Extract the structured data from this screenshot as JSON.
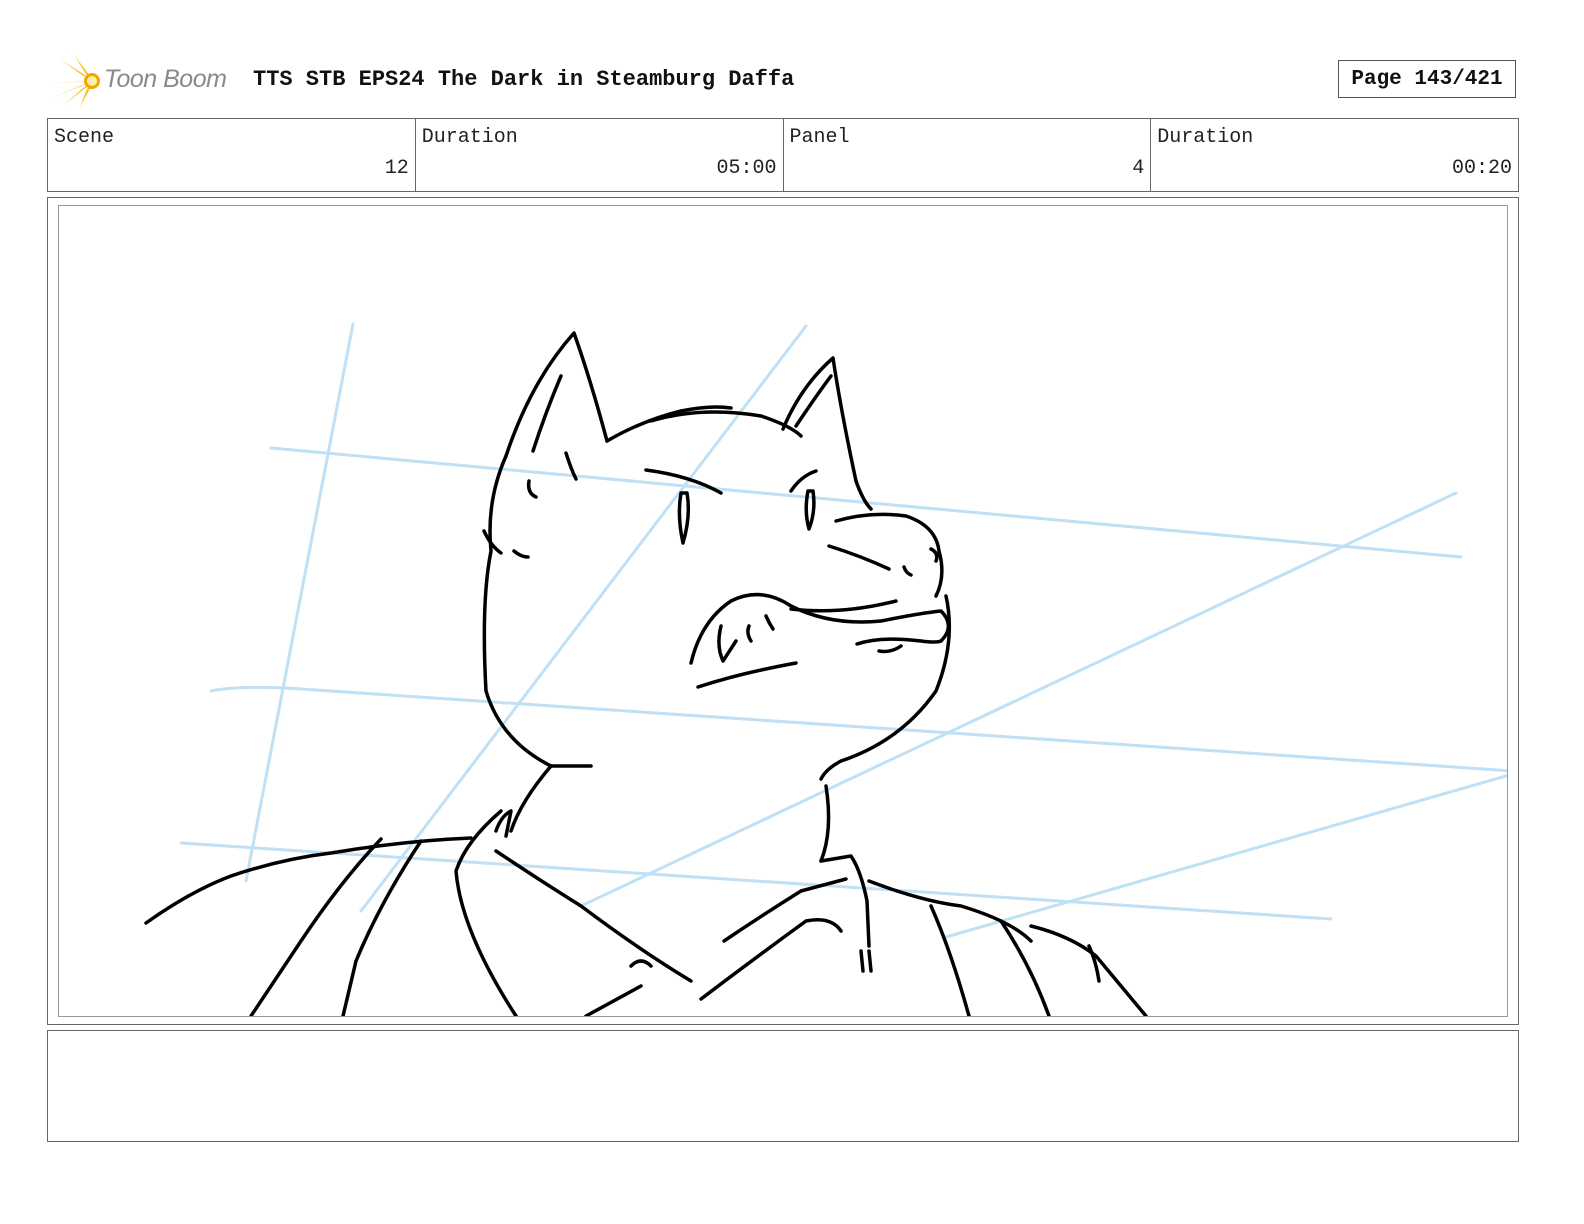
{
  "header": {
    "logo_text": "Toon Boom",
    "title": "TTS STB EPS24 The Dark in Steamburg Daffa",
    "page_label": "Page 143/421"
  },
  "info": {
    "scene_label": "Scene",
    "scene_value": "12",
    "scene_duration_label": "Duration",
    "scene_duration_value": "05:00",
    "panel_label": "Panel",
    "panel_value": "4",
    "panel_duration_label": "Duration",
    "panel_duration_value": "00:20"
  },
  "panel": {
    "image": "sketch of wolf character in collared jacket looking up-right, with blue perspective guide lines"
  },
  "notes": {
    "text": ""
  },
  "colors": {
    "border": "#666666",
    "sketch_line": "#000000",
    "guide_line": "#bfe0f5",
    "logo_yellow": "#f5c21b",
    "logo_text": "#8a8a8a"
  }
}
